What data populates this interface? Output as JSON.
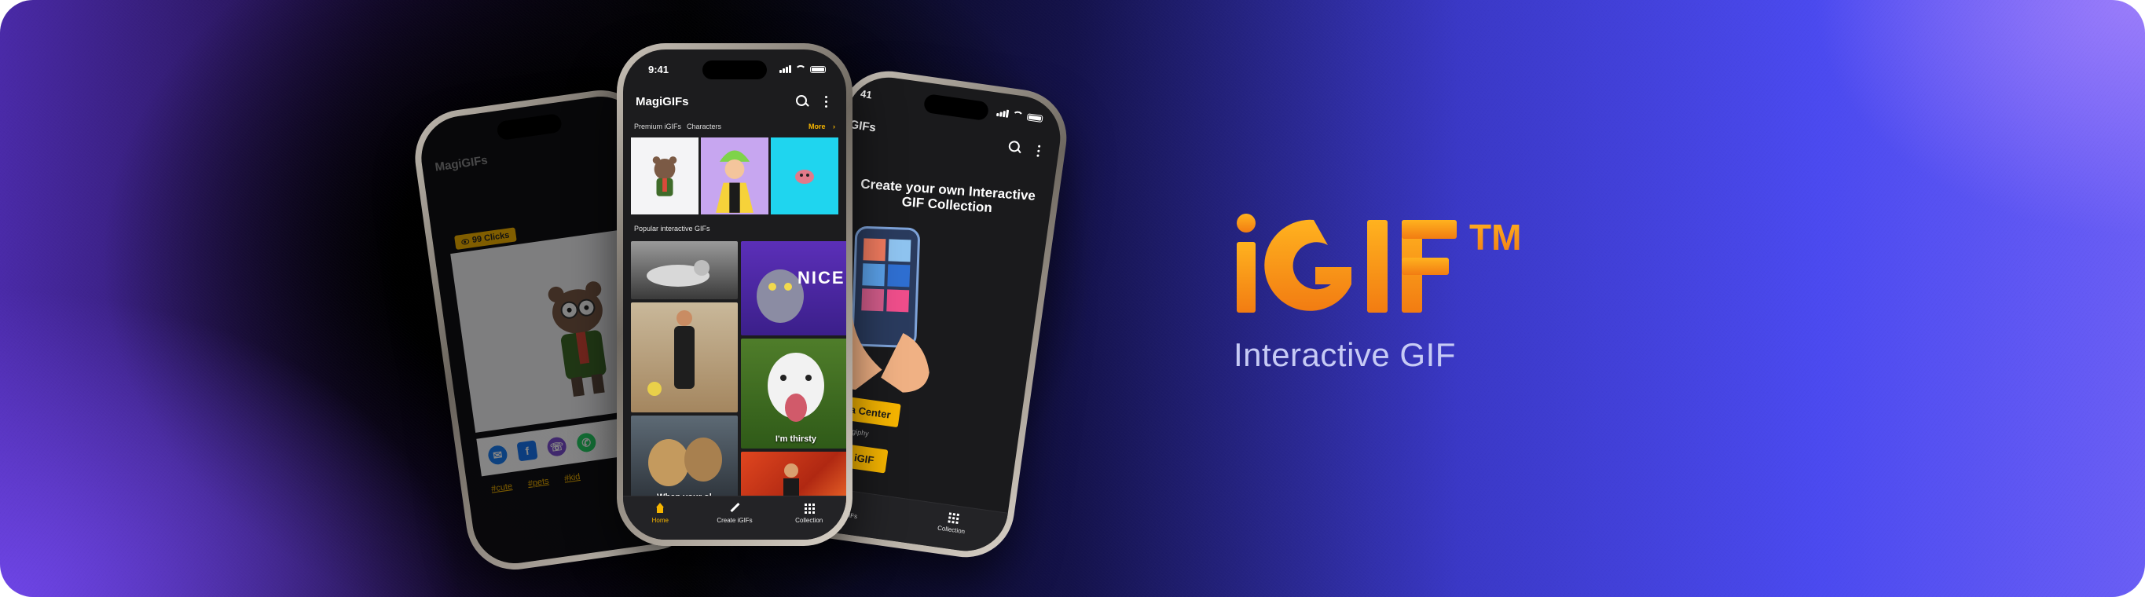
{
  "colors": {
    "accent": "#f6b500",
    "brand_orange": "#f7941d",
    "banner_right": "#4b4af0"
  },
  "brand": {
    "name": "iGIF",
    "trademark": "TM",
    "subtitle": "Interactive GIF"
  },
  "status_bar": {
    "time": "9:41"
  },
  "center_phone": {
    "app_title": "MagiGIFs",
    "categories": [
      "Premium iGIFs",
      "Characters"
    ],
    "more_label": "More",
    "section_label": "Popular interactive GIFs",
    "gif_captions": [
      "NICE",
      "I'm thirsty",
      "When your ol"
    ],
    "tabs": [
      {
        "label": "Home",
        "icon": "home-icon",
        "active": true
      },
      {
        "label": "Create iGIFs",
        "icon": "pencil-icon",
        "active": false
      },
      {
        "label": "Collection",
        "icon": "grid-icon",
        "active": false
      }
    ]
  },
  "right_phone": {
    "app_title_partial": "GIFs",
    "time_partial": "41",
    "headline": "Create your own Interactive GIF Collection",
    "media_center_button": "Media Center",
    "powered_by": "d by  tenor  &  giphy",
    "selfie_button": "Selfie iGIF",
    "tabs": [
      {
        "label": "ate iGIFs",
        "icon": "pencil-icon"
      },
      {
        "label": "Collection",
        "icon": "grid-icon"
      }
    ]
  },
  "left_phone": {
    "app_title": "MagiGIFs",
    "clicks_badge": "99 Clicks",
    "share_icons": [
      "messenger-icon",
      "facebook-icon",
      "viber-icon",
      "whatsapp-icon"
    ],
    "tags": [
      "#cute",
      "#pets",
      "#kid"
    ]
  }
}
